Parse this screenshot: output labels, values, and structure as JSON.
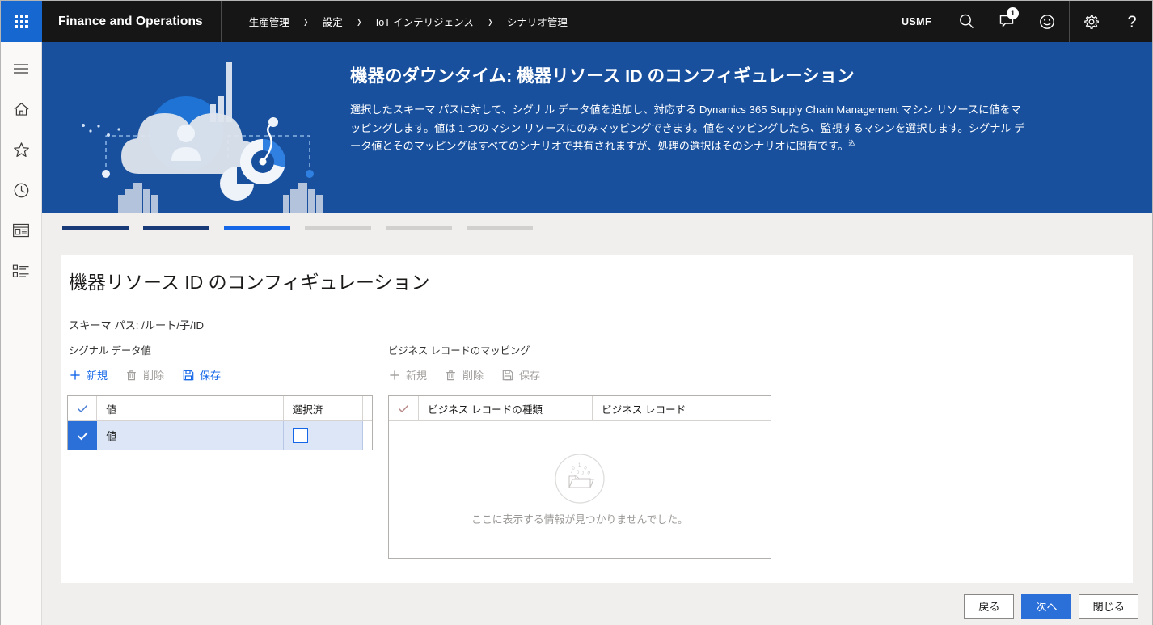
{
  "topbar": {
    "waffle_label": "app-launcher",
    "app_title": "Finance and Operations",
    "breadcrumbs": [
      {
        "label": "生産管理"
      },
      {
        "label": "設定"
      },
      {
        "label": "IoT インテリジェンス"
      },
      {
        "label": "シナリオ管理"
      }
    ],
    "chevron": "›",
    "company": "USMF",
    "icons": [
      {
        "name": "search-icon"
      },
      {
        "name": "notifications-icon",
        "badge": "1"
      },
      {
        "name": "feedback-smiley-icon"
      },
      {
        "name": "settings-gear-icon"
      },
      {
        "name": "help-question-icon"
      }
    ]
  },
  "rail": {
    "items": [
      {
        "name": "hamburger-menu-icon"
      },
      {
        "name": "home-icon"
      },
      {
        "name": "favorites-star-icon"
      },
      {
        "name": "recent-clock-icon"
      },
      {
        "name": "workspaces-icon"
      },
      {
        "name": "modules-list-icon"
      }
    ]
  },
  "hero": {
    "title": "機器のダウンタイム: 機器リソース ID のコンフィギュレーション",
    "description": "選択したスキーマ パスに対して、シグナル データ値を追加し、対応する Dynamics 365 Supply Chain Management マシン リソースに値をマッピングします。値は 1 つのマシン リソースにのみマッピングできます。値をマッピングしたら、監視するマシンを選択します。シグナル データ値とそのマッピングはすべてのシナリオで共有されますが、処理の選択はそのシナリオに固有です。",
    "description_sup": "込"
  },
  "steps": [
    {
      "state": "done"
    },
    {
      "state": "done"
    },
    {
      "state": "current"
    },
    {
      "state": "todo"
    },
    {
      "state": "todo"
    },
    {
      "state": "todo"
    }
  ],
  "page": {
    "title": "機器リソース ID のコンフィギュレーション",
    "schema_path": "スキーマ パス: /ルート/子/ID"
  },
  "left_panel": {
    "label": "シグナル データ値",
    "toolbar": {
      "new": "新規",
      "delete": "削除",
      "save": "保存"
    },
    "grid": {
      "columns": [
        "値",
        "選択済"
      ],
      "rows": [
        {
          "value": "値",
          "selected": false
        }
      ]
    }
  },
  "right_panel": {
    "label": "ビジネス レコードのマッピング",
    "toolbar": {
      "new": "新規",
      "delete": "削除",
      "save": "保存"
    },
    "grid": {
      "columns": [
        "ビジネス レコードの種類",
        "ビジネス レコード"
      ],
      "empty_message": "ここに表示する情報が見つかりませんでした。",
      "empty_icon": "empty-folder-data-icon"
    }
  },
  "footer": {
    "back": "戻る",
    "next": "次へ",
    "close": "閉じる"
  },
  "colors": {
    "brand_blue": "#1767d1",
    "hero_blue": "#18509e",
    "accent": "#1567e8",
    "primary_button": "#2b6fd8",
    "step_done": "#183a76",
    "step_todo": "#d2d0ce",
    "page_bg": "#f0efee",
    "topbar_bg": "#161616"
  }
}
